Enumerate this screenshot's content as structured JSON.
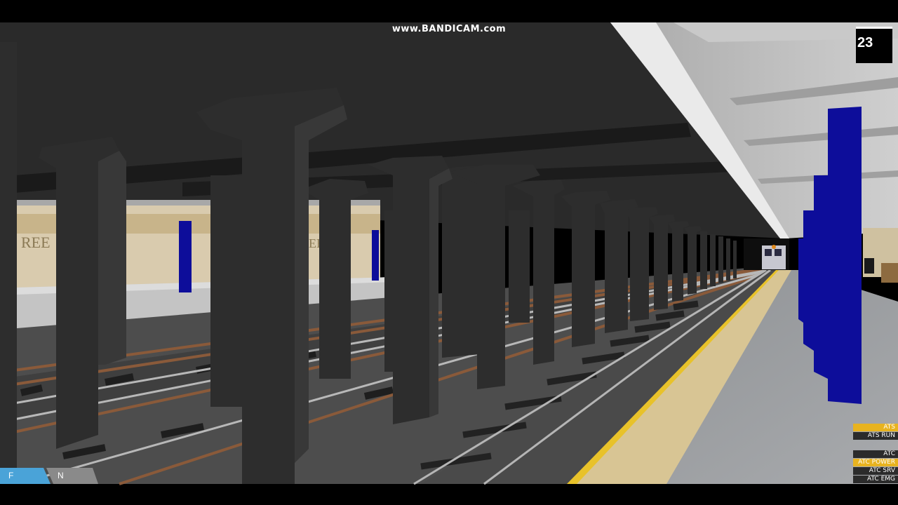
{
  "overlay": {
    "watermark": "www.BANDICAM.com",
    "speed": "23"
  },
  "signs": {
    "station_fragment_left": "REE",
    "station_fragment_mid": "REE"
  },
  "tabs": {
    "f_label": "F",
    "n_label": "N"
  },
  "indicators": {
    "ats": "ATS",
    "ats_run": "ATS RUN",
    "atc": "ATC",
    "atc_power": "ATC POWER",
    "atc_srv": "ATC SRV",
    "atc_emg": "ATC EMG"
  },
  "colors": {
    "accent_blue": "#0d0d9a",
    "indicator_on": "#e8b320",
    "tab_active": "#4aa3d8"
  }
}
